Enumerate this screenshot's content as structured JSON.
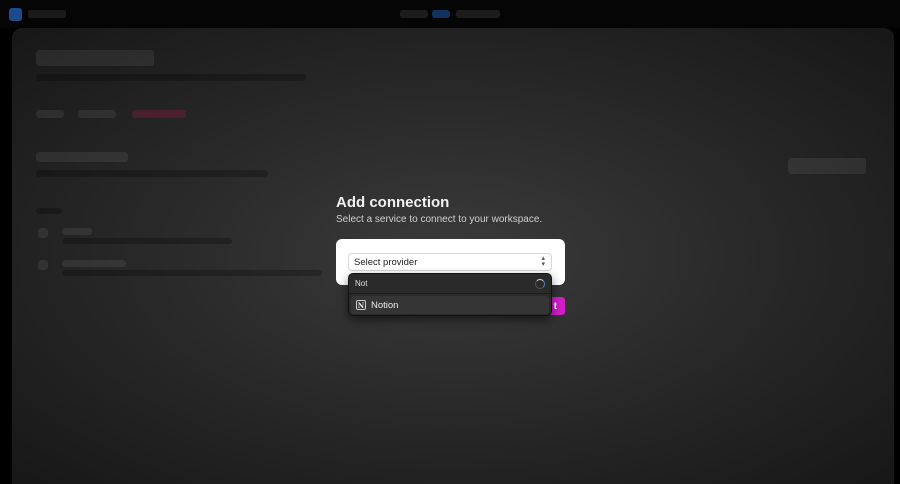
{
  "modal": {
    "title": "Add connection",
    "subtitle": "Select a service to connect to your workspace.",
    "select_placeholder": "Select provider",
    "confirm_label": "t"
  },
  "dropdown": {
    "search_value": "Not",
    "options": [
      {
        "label": "Notion",
        "icon": "notion-icon"
      }
    ]
  },
  "colors": {
    "accent": "#d21ec9",
    "nav_active": "#10335e"
  }
}
